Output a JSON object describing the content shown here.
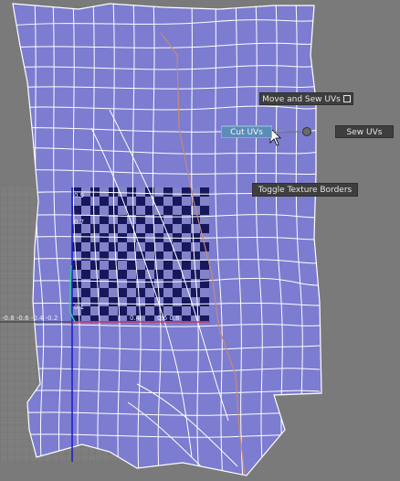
{
  "marking_menu": {
    "move_and_sew": {
      "label": "Move and Sew UVs",
      "icon": "option-box-icon"
    },
    "cut_uvs": {
      "label": "Cut UVs",
      "state": "highlighted"
    },
    "sew_uvs": {
      "label": "Sew UVs"
    },
    "toggle_texture_borders": {
      "label": "Toggle Texture Borders"
    }
  },
  "uv_grid": {
    "tick_labels": {
      "v_top": "0.9",
      "v_upper": "0.7",
      "v_lower": "0.1",
      "u_left": "-0.8  -0.6  -0.4  -0.2",
      "u_mid": "0.4",
      "u_right": "0.6  0.8"
    }
  },
  "colors": {
    "viewport_background": "#7a7a7a",
    "uv_shell_fill": "#7d7dcf",
    "uv_edges": "#ffffff",
    "texture_dark": "#14145a",
    "texture_light": "#8080c8",
    "menu_item_bg": "#3e3e3e",
    "menu_highlight_bg": "#5b8db6",
    "seam_line": "#c58a7a"
  }
}
